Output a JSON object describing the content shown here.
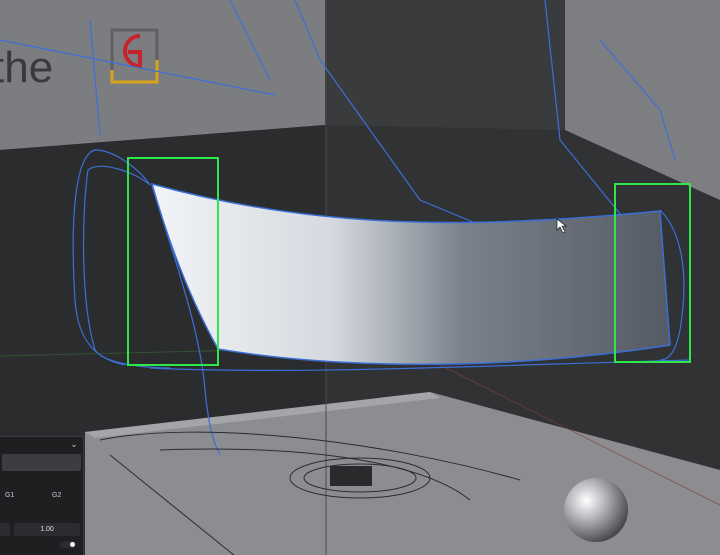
{
  "scene": {
    "wall_text": "the",
    "logo_letter": "G"
  },
  "panel": {
    "chevron_icon": "chevron-down-icon",
    "g1_label": "G1",
    "g2_label": "G2",
    "continuity_value": "1.00"
  },
  "colors": {
    "selection_box": "#2ee84a",
    "curve": "#3c6fd6",
    "surface_light": "#e6e9ee",
    "surface_dark": "#59606a"
  }
}
